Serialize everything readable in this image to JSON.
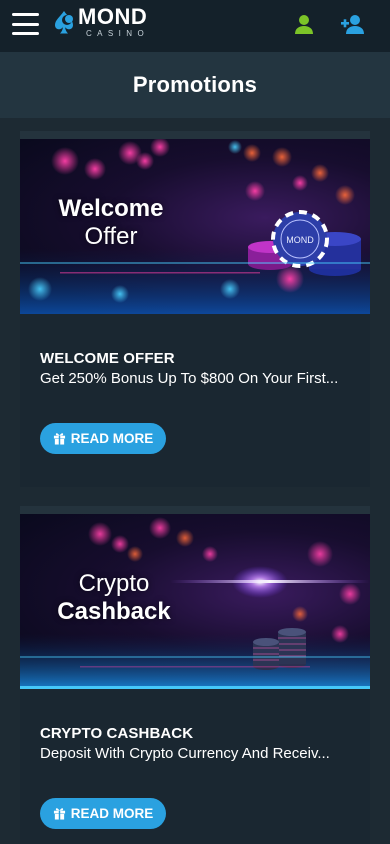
{
  "header": {
    "logo_word": "MOND",
    "logo_sub": "CASINO",
    "colors": {
      "user_icon": "#7cc428",
      "add_user_icon": "#2aa1e0",
      "header_bg": "#14212a"
    }
  },
  "page": {
    "title": "Promotions"
  },
  "promotions": [
    {
      "banner_line1": "Welcome",
      "banner_line2": "Offer",
      "heading": "WELCOME OFFER",
      "description": "Get 250% Bonus Up To $800 On Your First...",
      "button_label": "READ MORE",
      "chip_text": "MOND"
    },
    {
      "banner_line1": "Crypto",
      "banner_line2": "Cashback",
      "heading": "CRYPTO CASHBACK",
      "description": "Deposit With Crypto Currency And Receiv...",
      "button_label": "READ MORE"
    }
  ],
  "accent": "#2aa1e0"
}
